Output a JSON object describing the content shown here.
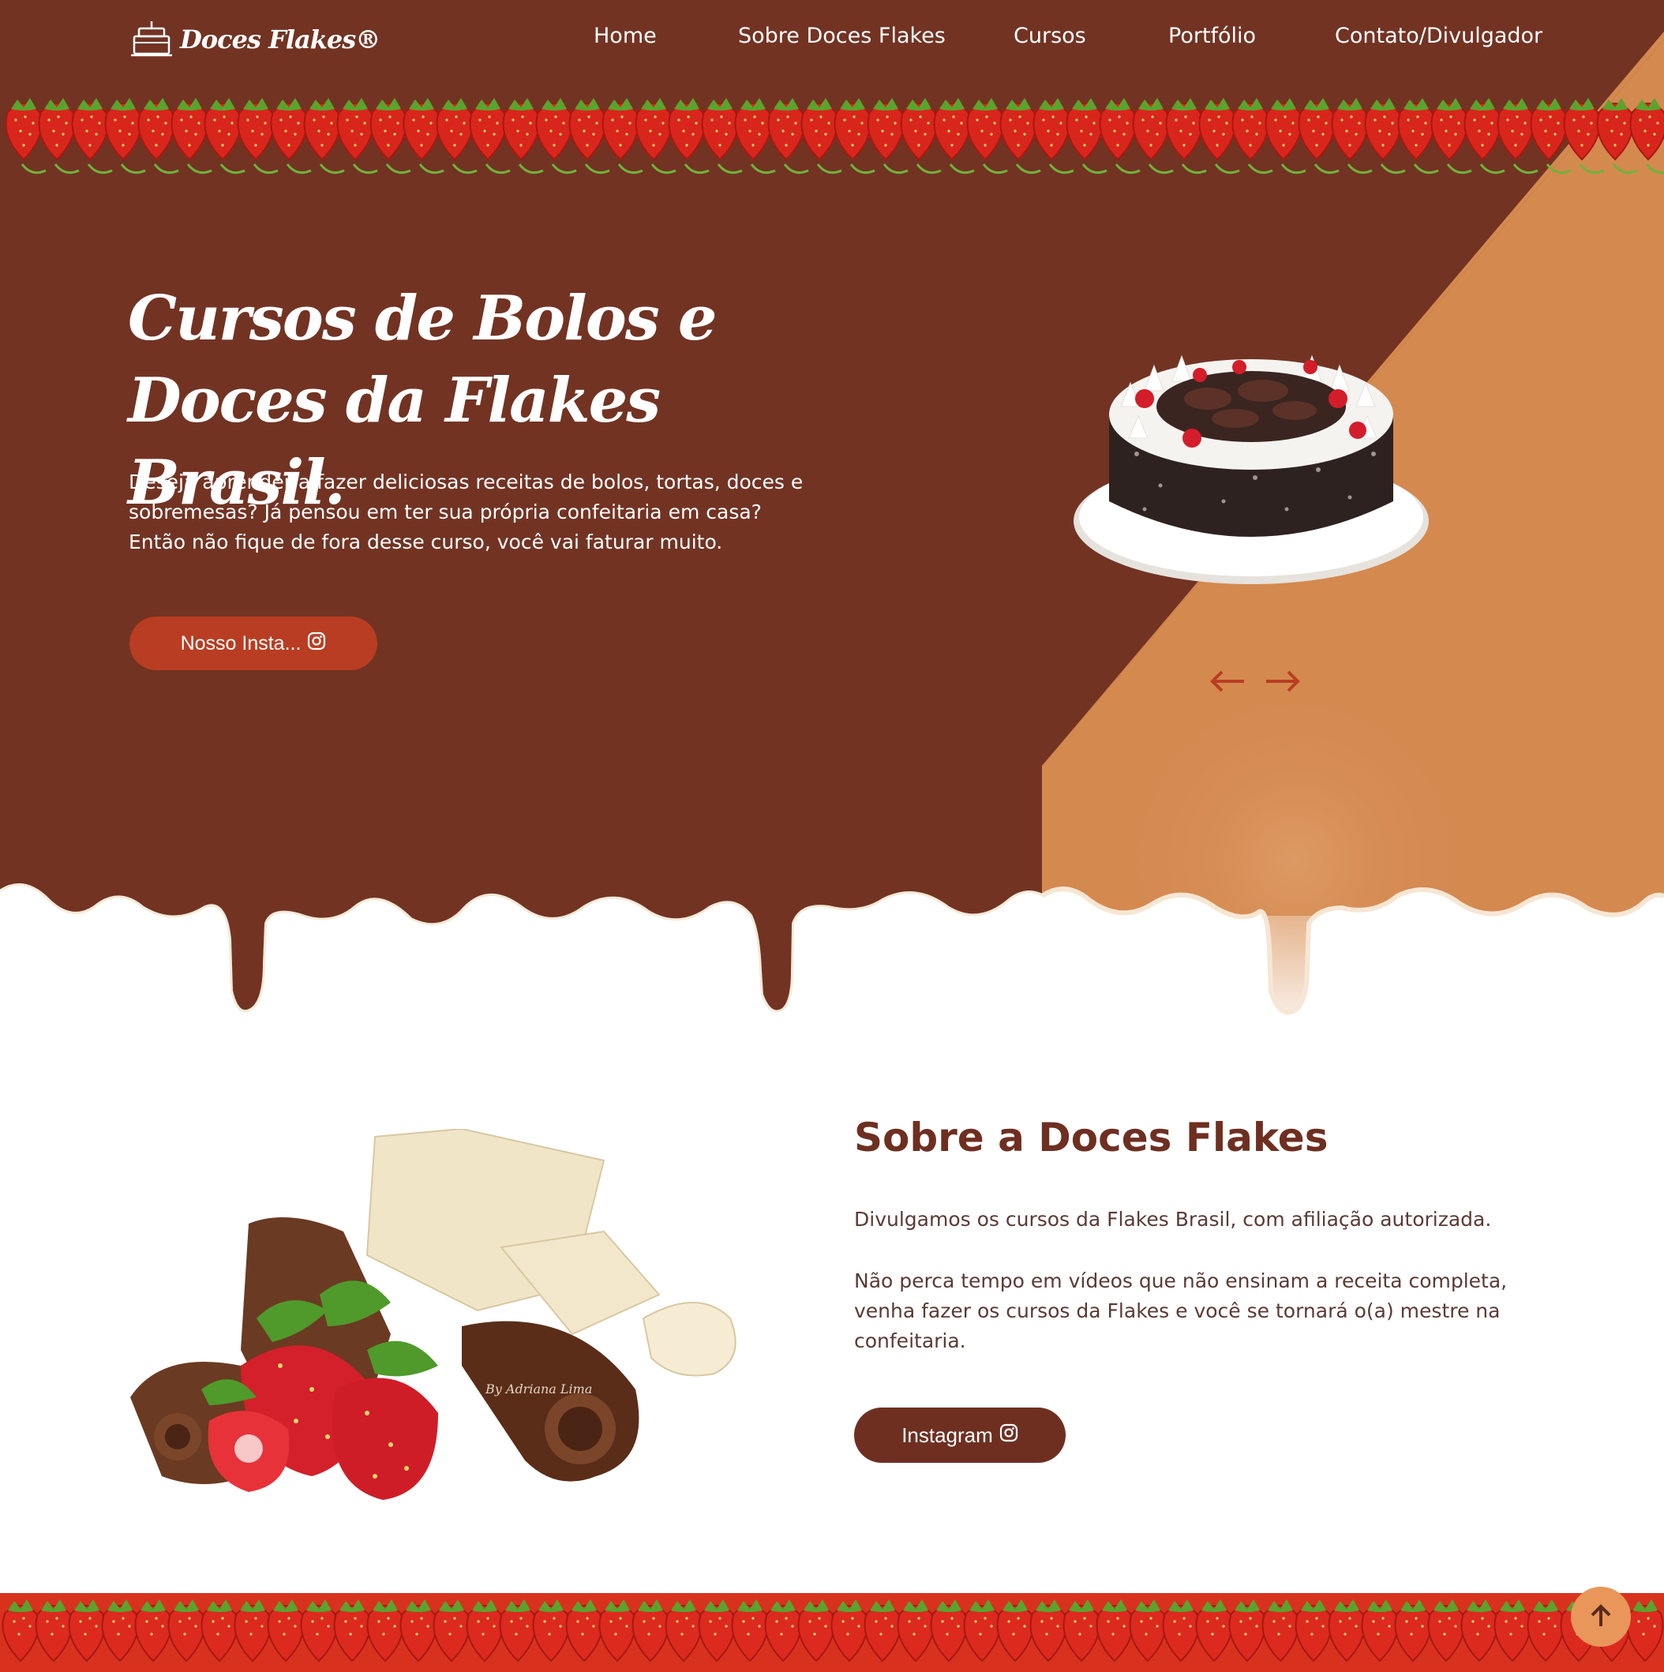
{
  "brand": {
    "name": "Doces Flakes®"
  },
  "nav": {
    "items": [
      {
        "label": "Home"
      },
      {
        "label": "Sobre Doces Flakes"
      },
      {
        "label": "Cursos"
      },
      {
        "label": "Portfólio"
      },
      {
        "label": "Contato/Divulgador"
      }
    ]
  },
  "hero": {
    "title_line1": "Cursos de Bolos e",
    "title_line2": "Doces da Flakes Brasil.",
    "text": "Deseja aprender a fazer deliciosas receitas de bolos, tortas, doces e sobremesas? Já pensou em ter sua própria confeitaria em casa? Então não fique de fora desse curso, você vai faturar muito.",
    "button_label": "Nosso Insta..."
  },
  "about": {
    "title": "Sobre a Doces Flakes",
    "paragraph1": "Divulgamos os cursos da Flakes Brasil, com afiliação autorizada.",
    "paragraph2": "Não perca tempo em vídeos que não ensinam a receita completa, venha fazer os cursos da Flakes e você se tornará o(a) mestre na confeitaria.",
    "button_label": "Instagram",
    "image_watermark": "By Adriana Lima"
  },
  "colors": {
    "chocolate": "#723323",
    "caramel": "#d4894f",
    "button_red": "#b93d22",
    "title_brown": "#6e2f21",
    "scroll_button": "#e9965a"
  },
  "icons": [
    "cake-logo-icon",
    "instagram-icon",
    "arrow-left-icon",
    "arrow-right-icon",
    "arrow-up-icon"
  ]
}
